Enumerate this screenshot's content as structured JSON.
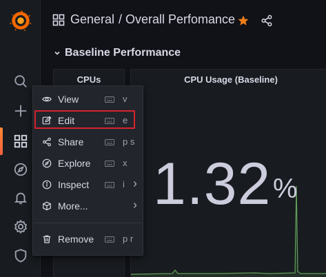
{
  "header": {
    "folder": "General",
    "title": "/ Overall Perfomance",
    "star_color": "#eb7b18"
  },
  "row": {
    "title": "Baseline Performance"
  },
  "panels": {
    "cpus": {
      "title": "CPUs"
    },
    "cpu_usage": {
      "title": "CPU Usage (Baseline)",
      "value": "1.32",
      "unit": "%"
    }
  },
  "sidebar": {
    "items": [
      "grafana-logo",
      "search-icon",
      "plus-icon",
      "dashboards-icon",
      "explore-icon",
      "alerting-icon",
      "configuration-icon",
      "server-admin-icon"
    ],
    "active": "dashboards-icon"
  },
  "menu": {
    "items": [
      {
        "label": "View",
        "key": "v",
        "icon": "eye-icon"
      },
      {
        "label": "Edit",
        "key": "e",
        "icon": "edit-icon"
      },
      {
        "label": "Share",
        "key": "p s",
        "icon": "share-icon"
      },
      {
        "label": "Explore",
        "key": "x",
        "icon": "compass-icon"
      },
      {
        "label": "Inspect",
        "key": "i",
        "icon": "info-icon"
      },
      {
        "label": "More...",
        "key": "",
        "icon": "cube-icon"
      },
      {
        "label": "Remove",
        "key": "p r",
        "icon": "trash-icon"
      }
    ]
  },
  "colors": {
    "accent": "#f55f3e",
    "highlight_box": "#d7232e",
    "sparkline": "#73bf69"
  }
}
